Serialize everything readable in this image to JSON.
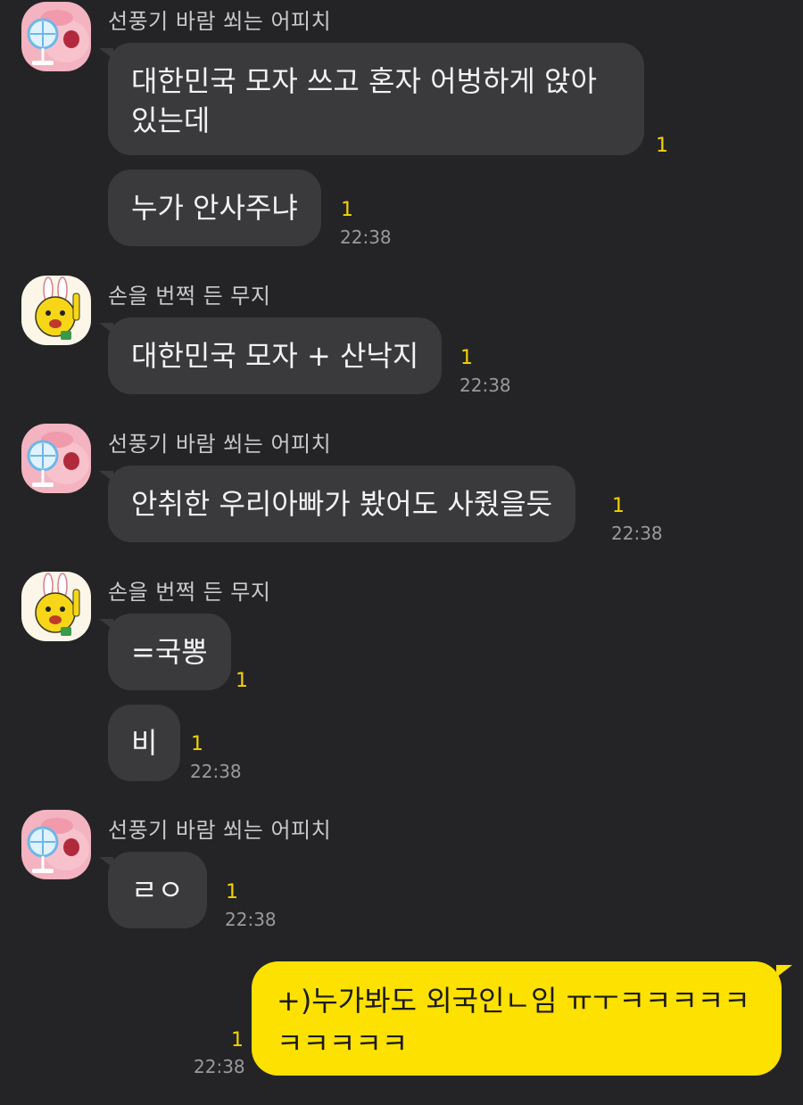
{
  "users": {
    "apeach": "선풍기 바람 쐬는 어피치",
    "muzi": "손을 번쩍 든 무지"
  },
  "icons": {
    "apeach_avatar": "apeach-fan-icon",
    "muzi_avatar": "muzi-hand-up-icon"
  },
  "messages": [
    {
      "text": "대한민국 모자 쓰고 혼자 어벙하게 앉아 있는데",
      "line1": "대한민국 모자 쓰고 혼자 어벙하게 앉아",
      "line2": "있는데",
      "unread": "1",
      "time": ""
    },
    {
      "text": "누가 안사주냐",
      "unread": "1",
      "time": "22:38"
    },
    {
      "text": "대한민국 모자 + 산낙지",
      "unread": "1",
      "time": "22:38"
    },
    {
      "text": "안취한 우리아빠가 봤어도 사줬을듯",
      "unread": "1",
      "time": "22:38"
    },
    {
      "text": "=국뽕",
      "unread": "1",
      "time": ""
    },
    {
      "text": "비",
      "unread": "1",
      "time": "22:38"
    },
    {
      "text": "ㄹㅇ",
      "unread": "1",
      "time": "22:38"
    },
    {
      "text": "+)누가봐도 외국인ㄴ임 ㅠㅜㅋㅋㅋㅋㅋ ㅋㅋㅋㅋㅋ",
      "line1": "+)누가봐도 외국인ㄴ임 ㅠㅜㅋㅋㅋㅋㅋ",
      "line2": "ㅋㅋㅋㅋㅋ",
      "unread": "1",
      "time": "22:38"
    }
  ],
  "colors": {
    "background": "#242426",
    "bubble_received": "#3a3a3d",
    "bubble_sent": "#fde100",
    "unread": "#f4d300",
    "time": "#9a9a9e"
  }
}
